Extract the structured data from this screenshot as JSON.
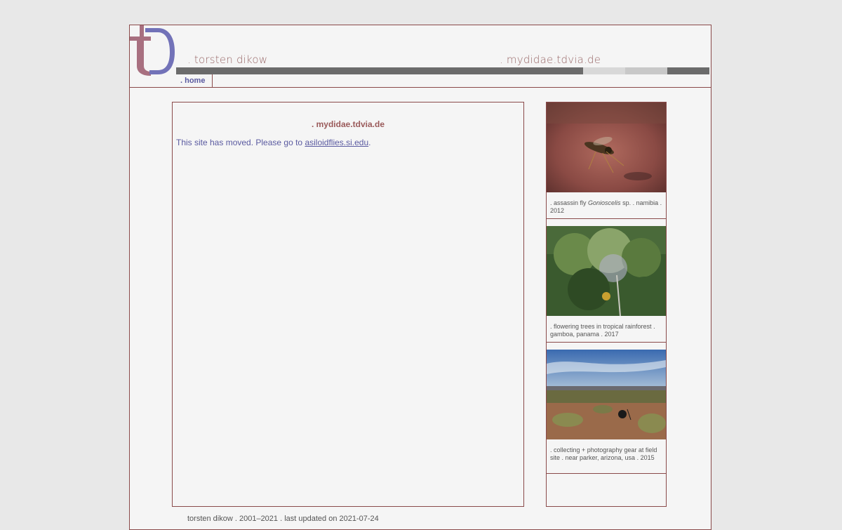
{
  "header": {
    "name": ". torsten dikow",
    "site": ". mydidae.tdvia.de",
    "logo_icon": "td-monogram-logo",
    "bar_colors": [
      "#6b6b6b",
      "#d8d8d8",
      "#c8c8c8",
      "#6b6b6b"
    ]
  },
  "nav": {
    "home_label": ". home"
  },
  "content": {
    "title": ". mydidae.tdvia.de",
    "message_prefix": "This site has moved. Please go to ",
    "link_text": "asiloidflies.si.edu",
    "message_suffix": "."
  },
  "sidebar": {
    "items": [
      {
        "caption_a": ". assassin fly ",
        "caption_italic": "Gonioscelis",
        "caption_b": " sp. . namibia . 2012"
      },
      {
        "caption_a": ". flowering trees in tropical rainforest . gamboa, panama . 2017"
      },
      {
        "caption_a": ". collecting + photography gear at field site . near parker, arizona, usa . 2015"
      }
    ]
  },
  "footer": {
    "text": "torsten dikow . 2001–2021 . last updated on 2021-07-24"
  }
}
